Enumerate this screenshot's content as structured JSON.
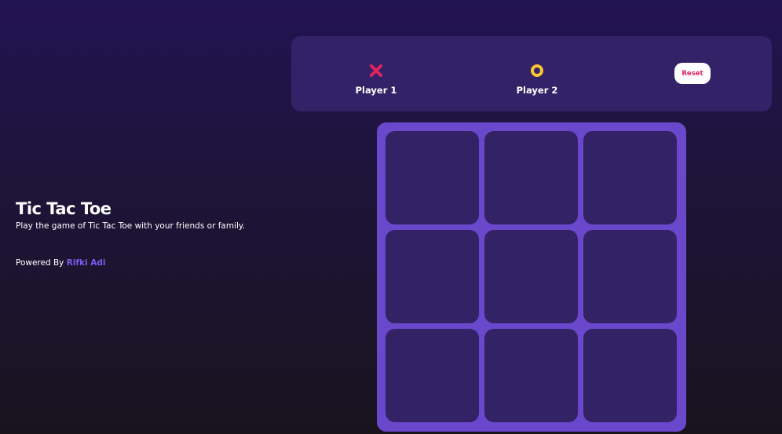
{
  "intro": {
    "title": "Tic Tac Toe",
    "subtitle": "Play the game of Tic Tac Toe with your friends or family.",
    "powered_prefix": "Powered By ",
    "author": "Rifki Adi"
  },
  "players": [
    {
      "name": "Player 1",
      "mark": "x",
      "icon": "x-mark-icon",
      "color": "#e0245e"
    },
    {
      "name": "Player 2",
      "mark": "o",
      "icon": "o-mark-icon",
      "color": "#f7c634"
    }
  ],
  "reset_label": "Reset",
  "board": {
    "cells": [
      "",
      "",
      "",
      "",
      "",
      "",
      "",
      "",
      ""
    ]
  },
  "colors": {
    "background_top": "#221352",
    "background_bottom": "#18141e",
    "panel": "#332267",
    "board": "#6a48cc",
    "cell": "#342266",
    "accent_link": "#7c5cf0",
    "x_mark": "#e0245e",
    "o_mark": "#f7c634"
  }
}
